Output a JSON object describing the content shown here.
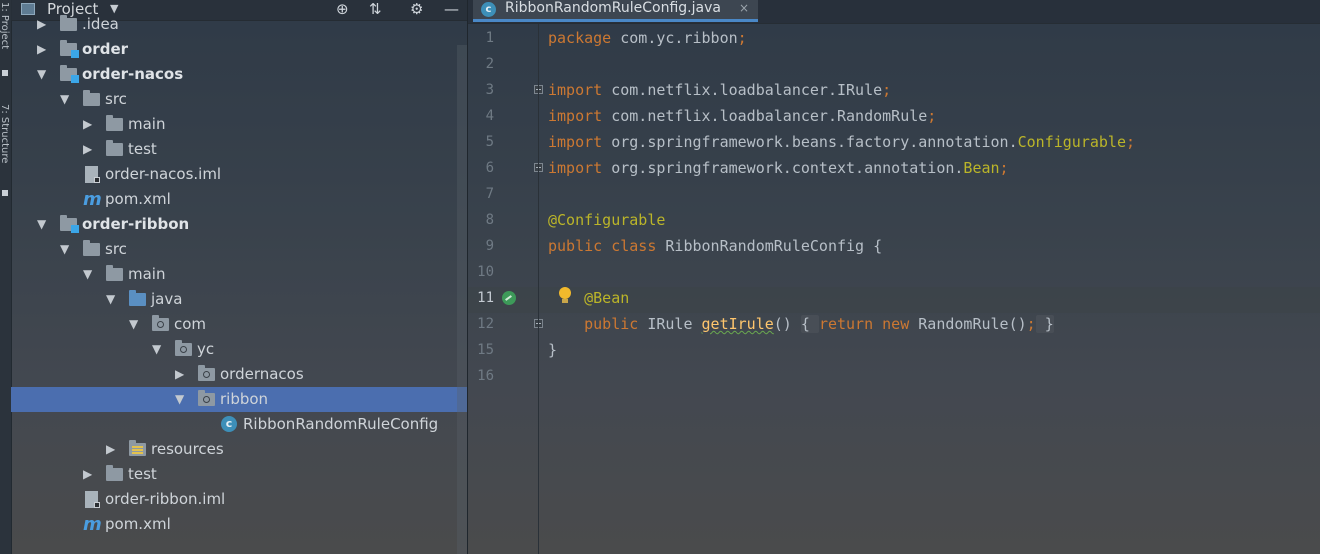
{
  "toolstrip": {
    "label_top": "1: Project",
    "label_bottom": "7: Structure"
  },
  "project_panel": {
    "title": "Project",
    "caret": "▼",
    "icons": [
      "crosshair-icon",
      "collapse-icon",
      "gear-icon",
      "minimize-icon"
    ],
    "tree": [
      {
        "label": ".idea",
        "depth": 0,
        "arrow": "▶",
        "icon": "folder",
        "bold": false
      },
      {
        "label": "order",
        "depth": 0,
        "arrow": "▶",
        "icon": "module",
        "bold": true
      },
      {
        "label": "order-nacos",
        "depth": 0,
        "arrow": "▼",
        "icon": "module",
        "bold": true
      },
      {
        "label": "src",
        "depth": 1,
        "arrow": "▼",
        "icon": "folder",
        "bold": false
      },
      {
        "label": "main",
        "depth": 2,
        "arrow": "▶",
        "icon": "folder",
        "bold": false
      },
      {
        "label": "test",
        "depth": 2,
        "arrow": "▶",
        "icon": "folder",
        "bold": false
      },
      {
        "label": "order-nacos.iml",
        "depth": 1,
        "arrow": "",
        "icon": "iml",
        "bold": false
      },
      {
        "label": "pom.xml",
        "depth": 1,
        "arrow": "",
        "icon": "maven",
        "bold": false
      },
      {
        "label": "order-ribbon",
        "depth": 0,
        "arrow": "▼",
        "icon": "module",
        "bold": true
      },
      {
        "label": "src",
        "depth": 1,
        "arrow": "▼",
        "icon": "folder",
        "bold": false
      },
      {
        "label": "main",
        "depth": 2,
        "arrow": "▼",
        "icon": "folder",
        "bold": false
      },
      {
        "label": "java",
        "depth": 3,
        "arrow": "▼",
        "icon": "source-folder",
        "bold": false
      },
      {
        "label": "com",
        "depth": 4,
        "arrow": "▼",
        "icon": "package",
        "bold": false
      },
      {
        "label": "yc",
        "depth": 5,
        "arrow": "▼",
        "icon": "package",
        "bold": false
      },
      {
        "label": "ordernacos",
        "depth": 6,
        "arrow": "▶",
        "icon": "package",
        "bold": false
      },
      {
        "label": "ribbon",
        "depth": 6,
        "arrow": "▼",
        "icon": "package",
        "bold": false,
        "selected": true
      },
      {
        "label": "RibbonRandomRuleConfig",
        "depth": 7,
        "arrow": "",
        "icon": "class",
        "bold": false
      },
      {
        "label": "resources",
        "depth": 3,
        "arrow": "▶",
        "icon": "resources",
        "bold": false
      },
      {
        "label": "test",
        "depth": 2,
        "arrow": "▶",
        "icon": "folder",
        "bold": false
      },
      {
        "label": "order-ribbon.iml",
        "depth": 1,
        "arrow": "",
        "icon": "iml",
        "bold": false
      },
      {
        "label": "pom.xml",
        "depth": 1,
        "arrow": "",
        "icon": "maven",
        "bold": false
      }
    ]
  },
  "editor": {
    "tab": {
      "label": "RibbonRandomRuleConfig.java",
      "close": "×",
      "icon_letter": "c"
    },
    "current_line": "11",
    "lines": [
      {
        "n": "1",
        "tokens": [
          [
            "kw",
            "package "
          ],
          [
            "",
            "com.yc.ribbon"
          ],
          [
            "kw",
            ";"
          ]
        ]
      },
      {
        "n": "2",
        "tokens": []
      },
      {
        "n": "3",
        "fold": true,
        "tokens": [
          [
            "kw",
            "import "
          ],
          [
            "",
            "com.netflix.loadbalancer.IRule"
          ],
          [
            "kw",
            ";"
          ]
        ]
      },
      {
        "n": "4",
        "tokens": [
          [
            "kw",
            "import "
          ],
          [
            "",
            "com.netflix.loadbalancer.RandomRule"
          ],
          [
            "kw",
            ";"
          ]
        ]
      },
      {
        "n": "5",
        "tokens": [
          [
            "kw",
            "import "
          ],
          [
            "",
            "org.springframework.beans.factory.annotation."
          ],
          [
            "an",
            "Configurable"
          ],
          [
            "kw",
            ";"
          ]
        ]
      },
      {
        "n": "6",
        "fold": true,
        "tokens": [
          [
            "kw",
            "import "
          ],
          [
            "",
            "org.springframework.context.annotation."
          ],
          [
            "an",
            "Bean"
          ],
          [
            "kw",
            ";"
          ]
        ]
      },
      {
        "n": "7",
        "tokens": []
      },
      {
        "n": "8",
        "tokens": [
          [
            "an",
            "@Configurable"
          ]
        ]
      },
      {
        "n": "9",
        "tokens": [
          [
            "kw",
            "public class "
          ],
          [
            "",
            "RibbonRandomRuleConfig {"
          ]
        ]
      },
      {
        "n": "10",
        "tokens": []
      },
      {
        "n": "11",
        "bulb": true,
        "gutter_icon": true,
        "tokens": [
          [
            "",
            "    "
          ],
          [
            "an",
            "@Bean"
          ]
        ]
      },
      {
        "n": "12",
        "fold": true,
        "tokens": [
          [
            "",
            "    "
          ],
          [
            "kw",
            "public "
          ],
          [
            "",
            "IRule "
          ],
          [
            "fn squig",
            "getIrule"
          ],
          [
            "",
            "() "
          ],
          [
            "inlay",
            "{ "
          ],
          [
            "kw",
            "return new "
          ],
          [
            "",
            "RandomRule()"
          ],
          [
            "kw",
            ";"
          ],
          [
            "inlay",
            " }"
          ]
        ]
      },
      {
        "n": "15",
        "tokens": [
          [
            "",
            "}"
          ]
        ]
      },
      {
        "n": "16",
        "tokens": []
      }
    ]
  }
}
